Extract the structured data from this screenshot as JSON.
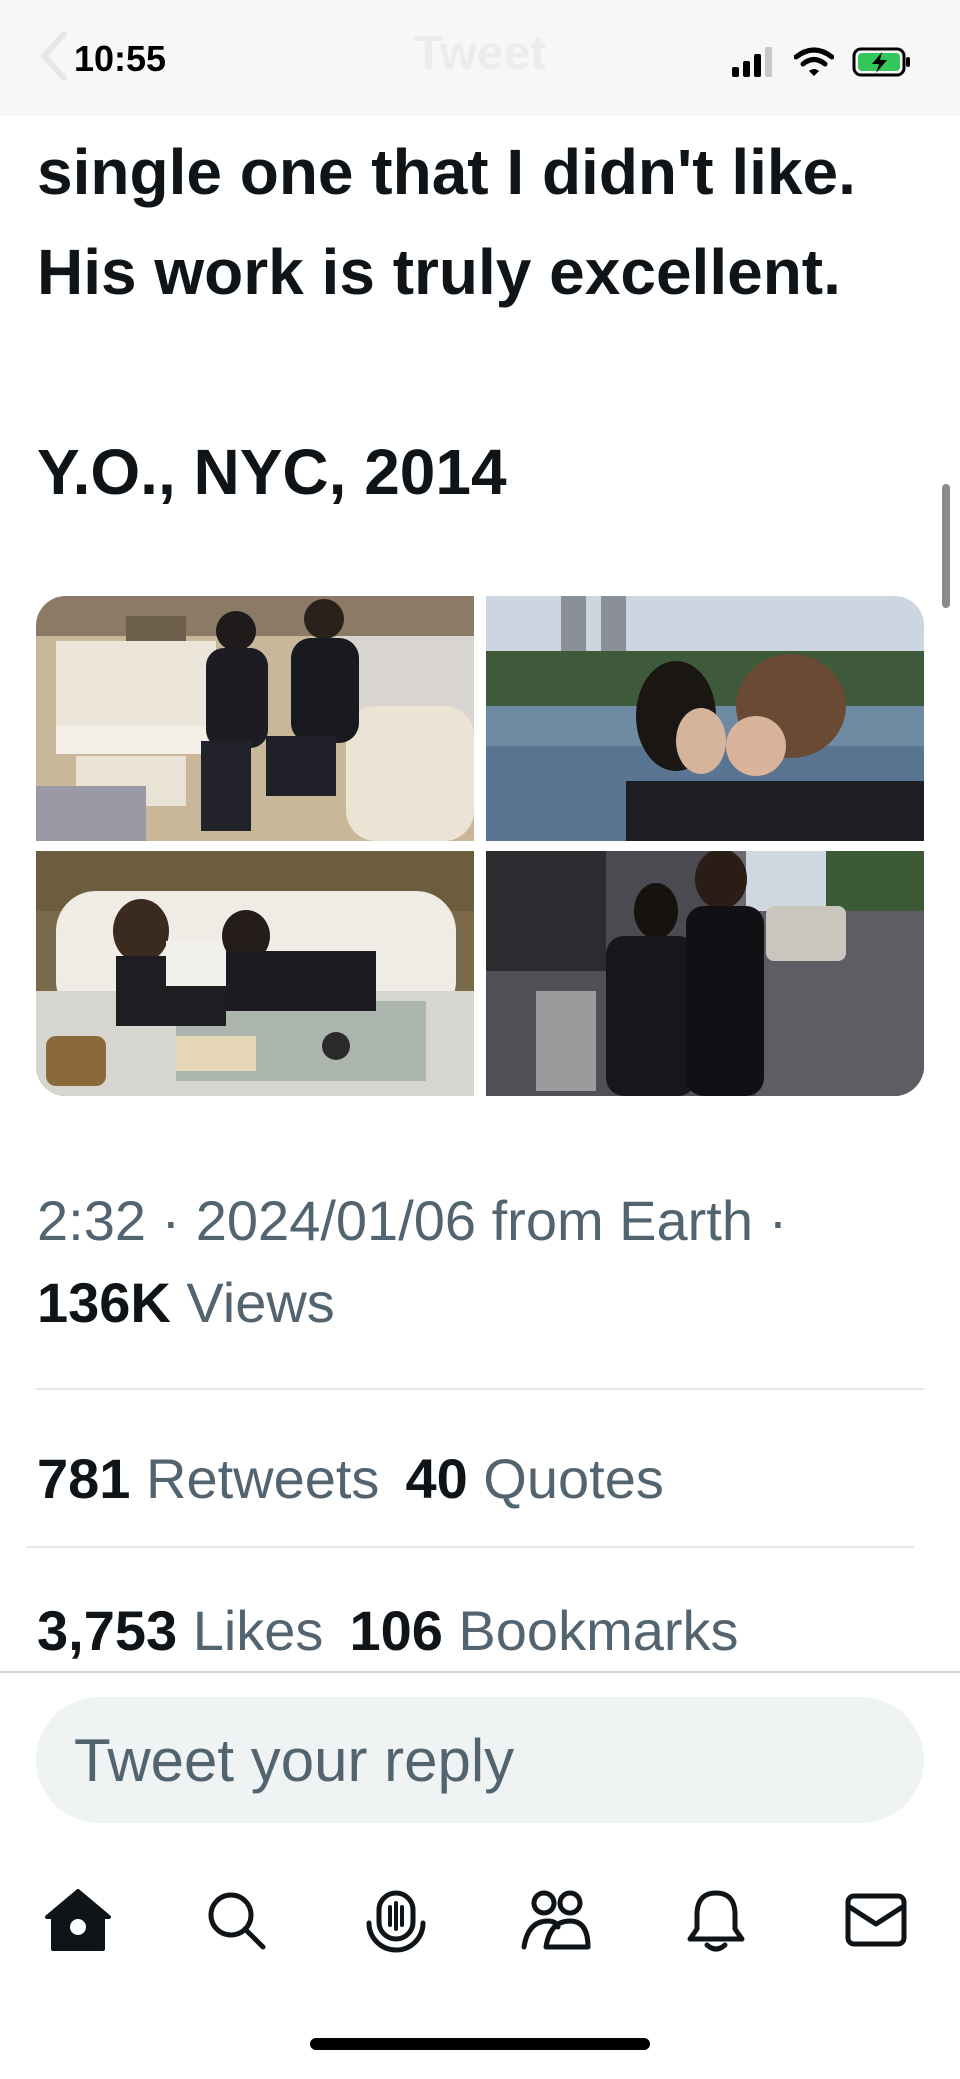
{
  "status_bar": {
    "time": "10:55",
    "ghost_title": "Tweet"
  },
  "tweet": {
    "text_lines": [
      "single one that I didn't like.",
      "His work is truly excellent.",
      "Y.O., NYC, 2014"
    ],
    "media_icons": [
      "photo-piano",
      "photo-kiss-lake",
      "photo-sofa-reading",
      "photo-street-couple"
    ],
    "meta": {
      "time": "2:32",
      "sep1": " · ",
      "date": "2024/01/06",
      "source": " from Earth",
      "sep2": " ·"
    },
    "views": {
      "count": "136K",
      "label": " Views"
    },
    "stats": {
      "retweets": {
        "count": "781",
        "label": " Retweets"
      },
      "quotes": {
        "count": "40",
        "label": " Quotes"
      },
      "likes": {
        "count": "3,753",
        "label": " Likes"
      },
      "bookmarks": {
        "count": "106",
        "label": " Bookmarks"
      }
    }
  },
  "reply": {
    "placeholder": "Tweet your reply"
  },
  "tabbar": {
    "icons": [
      "home-icon",
      "search-icon",
      "spaces-icon",
      "communities-icon",
      "notifications-icon",
      "messages-icon"
    ]
  },
  "colors": {
    "text": "#0f1419",
    "secondary": "#536471",
    "reply_bg": "#eff3f4",
    "battery": "#34c759"
  }
}
